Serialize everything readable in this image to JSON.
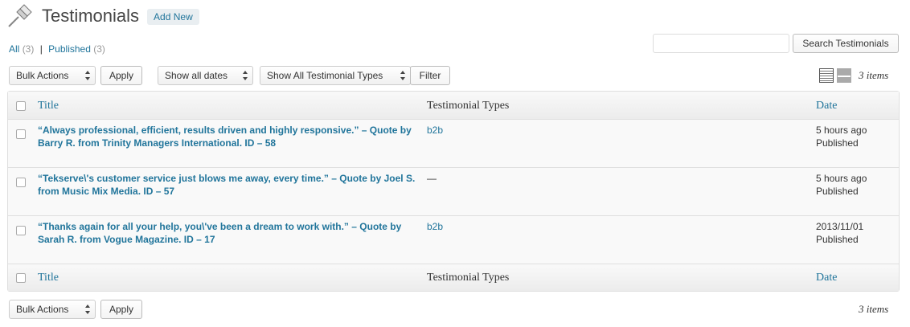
{
  "header": {
    "title": "Testimonials",
    "add_new_label": "Add New"
  },
  "filters": {
    "all_label": "All",
    "all_count": "(3)",
    "separator": "|",
    "published_label": "Published",
    "published_count": "(3)"
  },
  "search": {
    "value": "",
    "placeholder": "",
    "button_label": "Search Testimonials"
  },
  "tablenav_top": {
    "bulk_actions": "Bulk Actions",
    "apply_label": "Apply",
    "dates_filter": "Show all dates",
    "types_filter": "Show All Testimonial Types",
    "filter_label": "Filter",
    "items_count": "3 items"
  },
  "table": {
    "columns": {
      "title": "Title",
      "types": "Testimonial Types",
      "date": "Date"
    },
    "rows": [
      {
        "title": "“Always professional, efficient, results driven and highly responsive.” – Quote by Barry R. from Trinity Managers International. ID – 58",
        "type": "b2b",
        "date": "5 hours ago",
        "status": "Published"
      },
      {
        "title": "“Tekserve\\'s customer service just blows me away, every time.” – Quote by Joel S. from Music Mix Media. ID – 57",
        "type": "—",
        "date": "5 hours ago",
        "status": "Published"
      },
      {
        "title": "“Thanks again for all your help, you\\'ve been a dream to work with.” – Quote by Sarah R. from Vogue Magazine. ID – 17",
        "type": "b2b",
        "date": "2013/11/01",
        "status": "Published"
      }
    ]
  },
  "tablenav_bottom": {
    "bulk_actions": "Bulk Actions",
    "apply_label": "Apply",
    "items_count": "3 items"
  },
  "colors": {
    "link": "#21759b",
    "border": "#dfdfdf",
    "row_bg": "#f9f9f9"
  }
}
